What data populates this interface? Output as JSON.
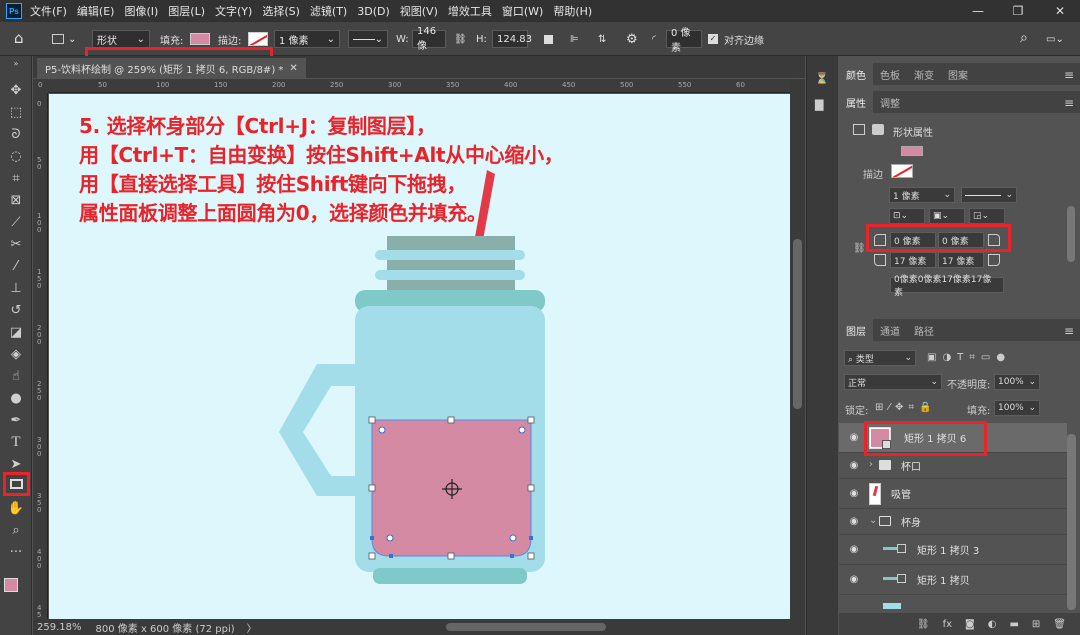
{
  "app": {
    "logo": "Ps"
  },
  "menu": [
    "文件(F)",
    "编辑(E)",
    "图像(I)",
    "图层(L)",
    "文字(Y)",
    "选择(S)",
    "滤镜(T)",
    "3D(D)",
    "视图(V)",
    "增效工具",
    "窗口(W)",
    "帮助(H)"
  ],
  "window_controls": {
    "minimize": "—",
    "restore": "❐",
    "close": "✕"
  },
  "options": {
    "mode": "形状",
    "fill_label": "填充:",
    "stroke_label": "描边:",
    "stroke_width": "1 像素",
    "w_label": "W:",
    "w_value": "146 像",
    "h_label": "H:",
    "h_value": "124.83",
    "radius_value": "0 像素",
    "align_edges_label": "对齐边缘"
  },
  "document": {
    "tab_title": "P5-饮料杯绘制 @ 259% (矩形 1 拷贝 6, RGB/8#) *",
    "tab_close": "✕",
    "ruler_top": [
      "0",
      "50",
      "100",
      "150",
      "200",
      "250",
      "300",
      "350",
      "400",
      "450",
      "500",
      "550",
      "60"
    ],
    "ruler_left": [
      "0",
      "5 0",
      "1 0 0",
      "1 5 0",
      "2 0 0",
      "2 5 0",
      "3 0 0",
      "3 5 0",
      "4 0 0",
      "4 5 0"
    ],
    "instructions": [
      "5. 选择杯身部分【Ctrl+J：复制图层】，",
      "用【Ctrl+T：自由变换】按住Shift+Alt从中心缩小，",
      "用【直接选择工具】按住Shift键向下拖拽，",
      "属性面板调整上面圆角为0，选择颜色并填充。"
    ]
  },
  "status": {
    "zoom": "259.18%",
    "doc_info": "800 像素 x 600 像素 (72 ppi)",
    "arrow": "〉"
  },
  "panels": {
    "top_tabs": [
      "颜色",
      "色板",
      "渐变",
      "图案"
    ],
    "props_tabs": [
      "属性",
      "调整"
    ],
    "shape_props_label": "形状属性",
    "stroke_label": "描边",
    "stroke_width": "1 像素",
    "corner_tl": "0 像素",
    "corner_tr": "0 像素",
    "corner_bl": "17 像素",
    "corner_br": "17 像素",
    "corners_summary": "0像素0像素17像素17像素",
    "layers_tabs": [
      "图层",
      "通道",
      "路径"
    ],
    "filter_kind": "类型",
    "blend_mode": "正常",
    "opacity_label": "不透明度:",
    "opacity_value": "100%",
    "lock_label": "锁定:",
    "fill_label": "填充:",
    "fill_value": "100%",
    "layers": [
      {
        "name": "矩形 1 拷贝 6"
      },
      {
        "name": "杯口"
      },
      {
        "name": "吸管"
      },
      {
        "name": "杯身"
      },
      {
        "name": "矩形 1 拷贝 3"
      },
      {
        "name": "矩形 1 拷贝"
      }
    ]
  },
  "colors": {
    "accent_red": "#e8242a",
    "fill_pink": "#d48aa3",
    "cup_body": "#a2dde9",
    "cup_dark": "#7fc9c9",
    "canvas_bg": "#def7fd"
  }
}
